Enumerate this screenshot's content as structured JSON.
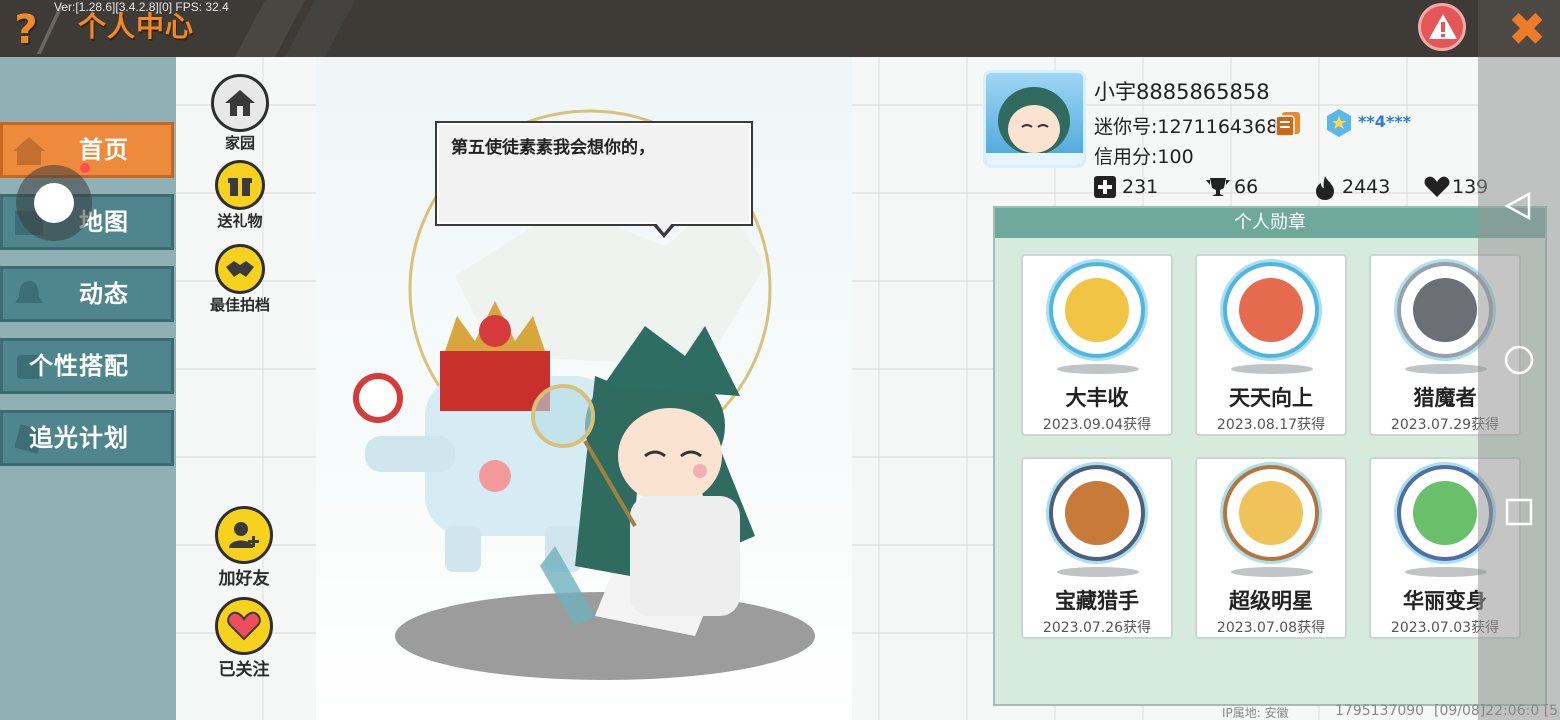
{
  "header": {
    "version": "Ver:[1.28.6][3.4.2.8][0] FPS: 32.4",
    "title": "个人中心",
    "help_icon": "?",
    "close_icon": "✖"
  },
  "nav": {
    "items": [
      {
        "label": "首页",
        "icon": "home-icon",
        "active": true
      },
      {
        "label": "地图",
        "icon": "map-icon",
        "active": false
      },
      {
        "label": "动态",
        "icon": "bell-icon",
        "active": false
      },
      {
        "label": "个性搭配",
        "icon": "outfit-icon",
        "active": false
      },
      {
        "label": "追光计划",
        "icon": "plan-icon",
        "active": false
      }
    ]
  },
  "actions": {
    "home": "家园",
    "gift": "送礼物",
    "partner": "最佳拍档",
    "add_friend": "加好友",
    "followed": "已关注"
  },
  "speech": {
    "text": "第五使徒素素我会想你的，"
  },
  "profile": {
    "username": "小宇8885865858",
    "mini_id": "迷你号:1271164368",
    "credit": "信用分:100",
    "vip": "**4***",
    "stats": [
      {
        "icon": "plus-icon",
        "value": "231"
      },
      {
        "icon": "trophy-icon",
        "value": "66"
      },
      {
        "icon": "fire-icon",
        "value": "2443"
      },
      {
        "icon": "heart-icon",
        "value": "139"
      }
    ]
  },
  "medals": {
    "title": "个人勋章",
    "items": [
      {
        "name": "大丰收",
        "date": "2023.09.04获得",
        "ring": "#4fb6e0",
        "core": "#f2c443"
      },
      {
        "name": "天天向上",
        "date": "2023.08.17获得",
        "ring": "#4fb6e0",
        "core": "#e56a4e"
      },
      {
        "name": "猎魔者",
        "date": "2023.07.29获得",
        "ring": "#9aa1a6",
        "core": "#6c6f74"
      },
      {
        "name": "宝藏猎手",
        "date": "2023.07.26获得",
        "ring": "#4d5f7a",
        "core": "#c77a3a"
      },
      {
        "name": "超级明星",
        "date": "2023.07.08获得",
        "ring": "#b4763a",
        "core": "#f0c35a"
      },
      {
        "name": "华丽变身",
        "date": "2023.07.03获得",
        "ring": "#4f6fa4",
        "core": "#6ac06a"
      }
    ]
  },
  "footer": {
    "ip": "IP属地: 安徽",
    "uid": "1795137090",
    "time": "[09/08]22:06:0  [5"
  },
  "colors": {
    "accent_orange": "#f08a24",
    "nav_teal": "#4f868d",
    "medal_panel": "#d7eade"
  }
}
